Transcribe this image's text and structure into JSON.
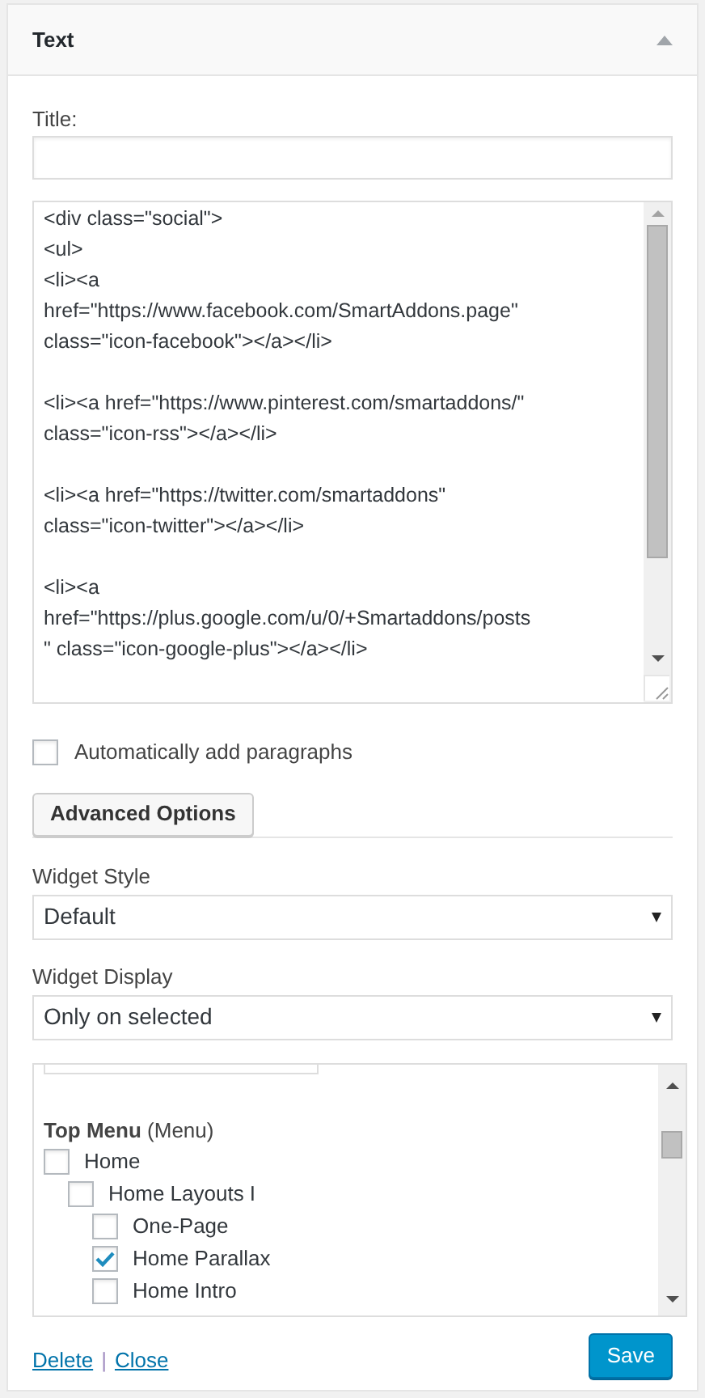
{
  "widget": {
    "title": "Text",
    "expanded": true
  },
  "title_field": {
    "label": "Title:"
  },
  "content_blocks": [
    [
      "<div class=\"social\">",
      "<ul>",
      "<li><a",
      "href=\"https://www.facebook.com/SmartAddons.page\"",
      "class=\"icon-facebook\"></a></li>"
    ],
    [
      "<li><a href=\"https://www.pinterest.com/smartaddons/\"",
      "class=\"icon-rss\"></a></li>"
    ],
    [
      "<li><a href=\"https://twitter.com/smartaddons\"",
      "class=\"icon-twitter\"></a></li>"
    ],
    [
      "<li><a",
      "href=\"https://plus.google.com/u/0/+Smartaddons/posts",
      "\" class=\"icon-google-plus\"></a></li>"
    ]
  ],
  "auto_paragraphs": {
    "label": "Automatically add paragraphs",
    "checked": false
  },
  "advanced_button": "Advanced Options",
  "widget_style": {
    "label": "Widget Style",
    "value": "Default"
  },
  "widget_display": {
    "label": "Widget Display",
    "value": "Only on selected"
  },
  "menu_tree": {
    "heading": "Top Menu",
    "heading_note": "(Menu)",
    "items": [
      {
        "label": "Home",
        "checked": false,
        "children": [
          {
            "label": "Home Layouts I",
            "checked": false,
            "children": [
              {
                "label": "One-Page",
                "checked": false
              },
              {
                "label": "Home Parallax",
                "checked": true
              },
              {
                "label": "Home Intro",
                "checked": false
              }
            ]
          }
        ]
      }
    ]
  },
  "links": [
    "Delete",
    "Close"
  ],
  "link_separator": "|",
  "save_button": "Save"
}
